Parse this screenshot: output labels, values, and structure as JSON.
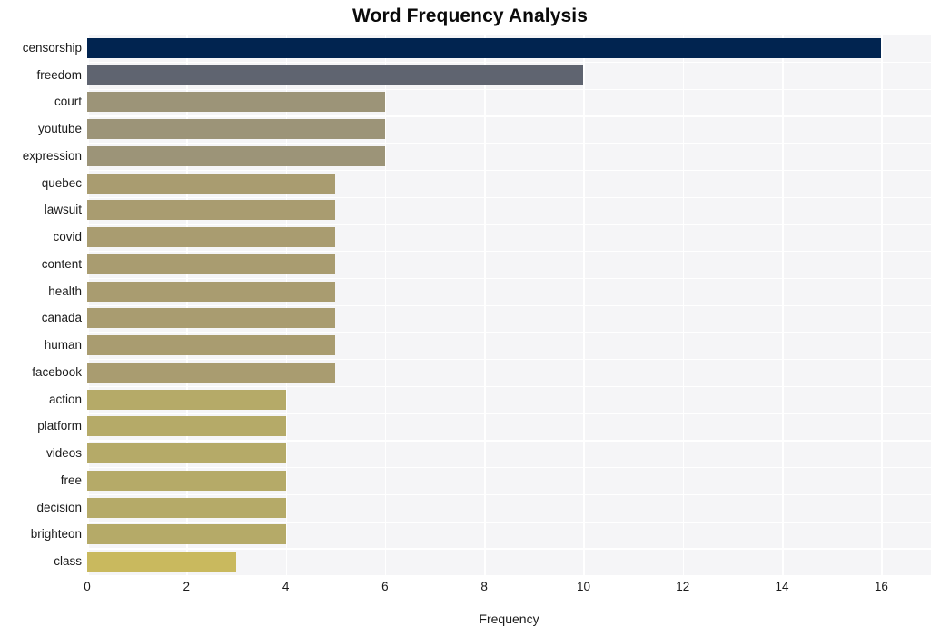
{
  "chart_data": {
    "type": "bar",
    "orientation": "horizontal",
    "title": "Word Frequency Analysis",
    "xlabel": "Frequency",
    "ylabel": "",
    "xlim": [
      0,
      17
    ],
    "xticks": [
      0,
      2,
      4,
      6,
      8,
      10,
      12,
      14,
      16
    ],
    "grid": true,
    "legend": null,
    "categories": [
      "censorship",
      "freedom",
      "court",
      "youtube",
      "expression",
      "quebec",
      "lawsuit",
      "covid",
      "content",
      "health",
      "canada",
      "human",
      "facebook",
      "action",
      "platform",
      "videos",
      "free",
      "decision",
      "brighteon",
      "class"
    ],
    "values": [
      16,
      10,
      6,
      6,
      6,
      5,
      5,
      5,
      5,
      5,
      5,
      5,
      5,
      4,
      4,
      4,
      4,
      4,
      4,
      3
    ],
    "bar_colors": [
      "#012450",
      "#5f6470",
      "#9c9478",
      "#9c9478",
      "#9c9478",
      "#a99c70",
      "#a99c70",
      "#a99c70",
      "#a99c70",
      "#a99c70",
      "#a99c70",
      "#a99c70",
      "#a99c70",
      "#b5aa68",
      "#b5aa68",
      "#b5aa68",
      "#b5aa68",
      "#b5aa68",
      "#b5aa68",
      "#c9b95e"
    ],
    "plot_background": "#f5f5f7",
    "grid_color": "#ffffff",
    "figure_background": "#ffffff",
    "text_color": "#1b1b1b"
  }
}
